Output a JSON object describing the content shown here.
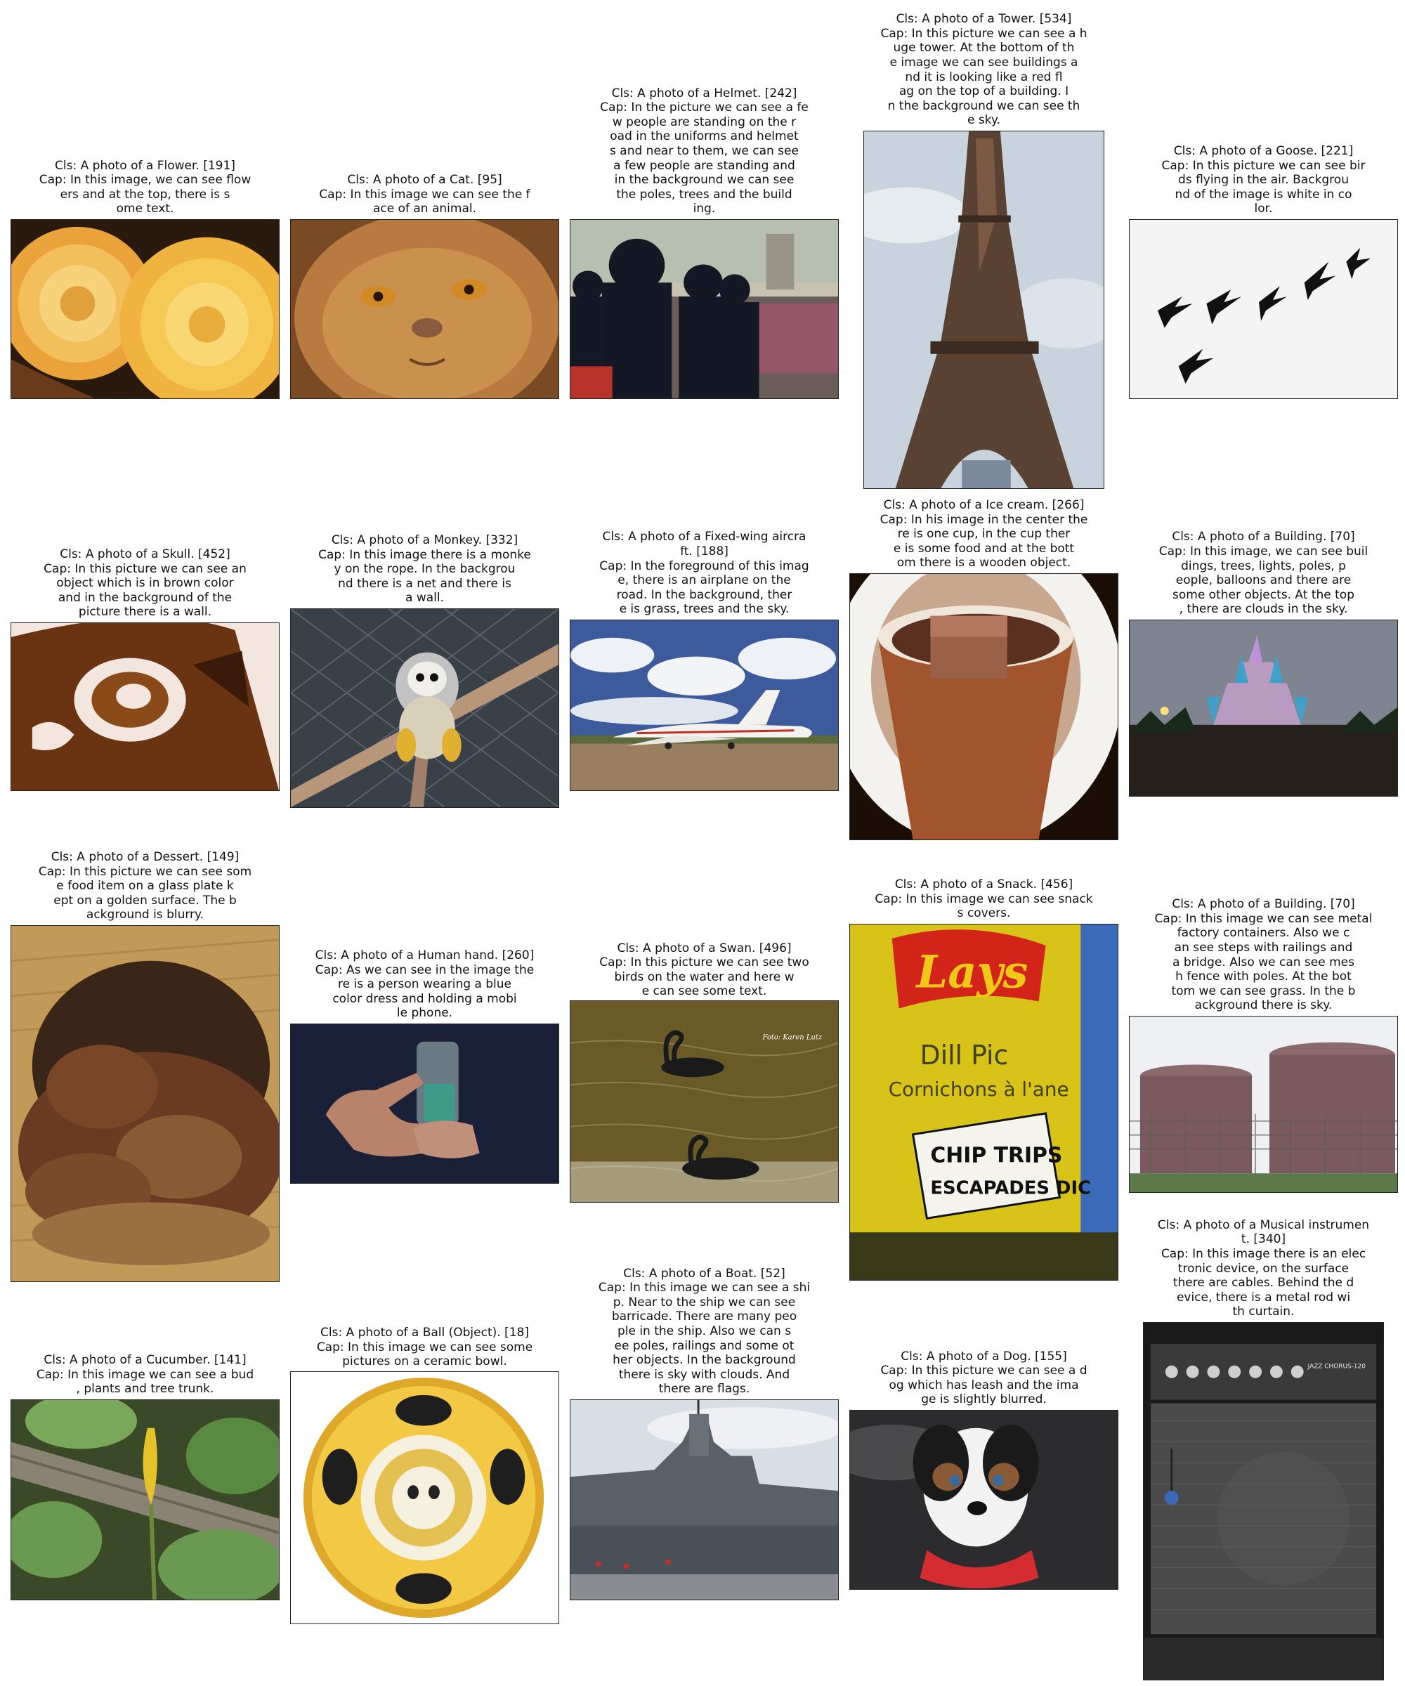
{
  "cells": [
    {
      "cls": "Cls: A photo of a Flower. [191]",
      "cap": "Cap: In this image, we can see flow\ners and at the top, there is s\nome text.",
      "picture": "yellow dahlia flowers"
    },
    {
      "cls": "Cls: A photo of a Cat. [95]",
      "cap": "Cap: In this image we can see the f\nace of an animal.",
      "picture": "persian cat face"
    },
    {
      "cls": "Cls: A photo of a Helmet. [242]",
      "cap": "Cap: In the picture we can see a fe\nw people are standing on the r\noad in the uniforms and helmet\ns and near to them, we can see\na few people are standing and\nin the background we can see\nthe poles, trees and the build\ning.",
      "picture": "police in helmets"
    },
    {
      "cls": "Cls: A photo of a Tower. [534]",
      "cap": "Cap: In this picture we can see a h\nuge tower. At the bottom of th\ne image we can see buildings a\nnd it is looking like a red fl\nag on the top of a building. I\nn the background we can see th\ne sky.",
      "picture": "eiffel tower"
    },
    {
      "cls": "Cls: A photo of a Goose. [221]",
      "cap": "Cap: In this picture we can see bir\nds flying in the air. Backgrou\nnd of the image is white in co\nlor.",
      "picture": "geese flying"
    },
    {
      "cls": "Cls: A photo of a Skull. [452]",
      "cap": "Cap: In this picture we can see an\nobject which is in brown color\nand in the background of the\npicture there is a wall.",
      "picture": "carved brown skull"
    },
    {
      "cls": "Cls: A photo of a Monkey. [332]",
      "cap": "Cap: In this image there is a monke\ny on the rope. In the backgrou\nnd there is a net and there is\na wall.",
      "picture": "squirrel monkey on rope"
    },
    {
      "cls": "Cls: A photo of a Fixed-wing aircra\nft. [188]",
      "cap": "Cap: In the foreground of this imag\ne, there is an airplane on the\nroad. In the background, ther\ne is grass, trees and the sky.",
      "picture": "jet airplane"
    },
    {
      "cls": "Cls: A photo of a Ice cream. [266]",
      "cap": "Cap: In his image in the center the\nre is one cup, in the cup ther\ne is some food and at the bott\nom there is a wooden object.",
      "picture": "ice cream cup"
    },
    {
      "cls": "Cls: A photo of a Building. [70]",
      "cap": "Cap: In this image, we can see buil\ndings, trees, lights, poles, p\neople, balloons and there are\nsome other objects. At the top\n, there are clouds in the sky.",
      "picture": "castle at dusk"
    },
    {
      "cls": "Cls: A photo of a Dessert. [149]",
      "cap": "Cap: In this picture we can see som\ne food item on a glass plate k\nept on a golden surface. The b\nackground is blurry.",
      "picture": "dessert on plate"
    },
    {
      "cls": "Cls: A photo of a Human hand. [260]",
      "cap": "Cap: As we can see in the image the\nre is a person wearing a blue\ncolor dress and holding a mobi\nle phone.",
      "picture": "hand holding phone"
    },
    {
      "cls": "Cls: A photo of a Swan. [496]",
      "cap": "Cap: In this picture we can see two\nbirds on the water and here w\ne can see some text.",
      "picture": "black swans",
      "overlay_text": "Foto: Karen Lutz"
    },
    {
      "cls": "Cls: A photo of a Snack. [456]",
      "cap": "Cap: In this image we can see snack\ns covers.",
      "picture": "chip bag",
      "bag_lines": [
        "Lays",
        "Dill Pic",
        "Cornichons à l'ane",
        "CHIP TRIPS",
        "ESCAPADES DIC"
      ]
    },
    {
      "cls": "Cls: A photo of a Building. [70]",
      "cap": "Cap: In this image we can see metal\nfactory containers. Also we c\nan see steps with railings and\na bridge. Also we can see mes\nh fence with poles. At the bot\ntom we can see grass. In the b\nackground there is sky.",
      "picture": "storage tanks"
    },
    {
      "cls": "Cls: A photo of a Cucumber. [141]",
      "cap": "Cap: In this image we can see a bud\n, plants and tree trunk.",
      "picture": "cucumber bud"
    },
    {
      "cls": "Cls: A photo of a Ball (Object). [18]",
      "cap": "Cap: In this image we can see some\npictures on a ceramic bowl.",
      "picture": "panda bowl"
    },
    {
      "cls": "Cls: A photo of a Boat. [52]",
      "cap": "Cap: In this image we can see a shi\np. Near to the ship we can see\nbarricade. There are many peo\nple in the ship. Also we can s\nee poles, railings and some ot\nher objects. In the background\nthere is sky with clouds. And\nthere are flags.",
      "picture": "navy ship"
    },
    {
      "cls": "Cls: A photo of a Dog. [155]",
      "cap": "Cap: In this picture we can see a d\nog which has leash and the ima\nge is slightly blurred.",
      "picture": "dog with bandana"
    },
    {
      "cls": "Cls: A photo of a Musical instrumen\nt. [340]",
      "cap": "Cap: In this image there is an elec\ntronic device, on the surface\nthere are cables. Behind the d\nevice, there is a metal rod wi\nth curtain.",
      "picture": "guitar amplifier",
      "amp_label": "JAZZ CHORUS-120"
    }
  ]
}
